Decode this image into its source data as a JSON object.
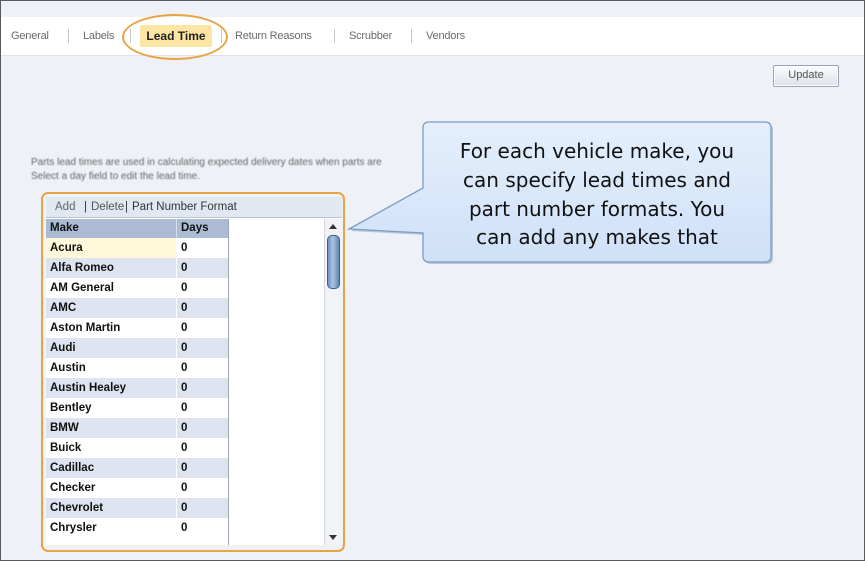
{
  "tabs": [
    {
      "label": "General"
    },
    {
      "label": "Labels"
    },
    {
      "label": "Lead Time",
      "active": true
    },
    {
      "label": "Return Reasons"
    },
    {
      "label": "Scrubber"
    },
    {
      "label": "Vendors"
    }
  ],
  "update_button": "Update",
  "description": {
    "line1": "Parts lead times are used in calculating expected delivery dates when parts are",
    "line2": "Select a day field to edit the lead time."
  },
  "toolbar": {
    "add": "Add",
    "sep1": "|",
    "delete": "Delete",
    "sep2": "|",
    "part_number_format": "Part Number Format"
  },
  "grid": {
    "columns": [
      "Make",
      "Days"
    ],
    "rows": [
      {
        "make": "Acura",
        "days": "0"
      },
      {
        "make": "Alfa Romeo",
        "days": "0"
      },
      {
        "make": "AM General",
        "days": "0"
      },
      {
        "make": "AMC",
        "days": "0"
      },
      {
        "make": "Aston Martin",
        "days": "0"
      },
      {
        "make": "Audi",
        "days": "0"
      },
      {
        "make": "Austin",
        "days": "0"
      },
      {
        "make": "Austin Healey",
        "days": "0"
      },
      {
        "make": "Bentley",
        "days": "0"
      },
      {
        "make": "BMW",
        "days": "0"
      },
      {
        "make": "Buick",
        "days": "0"
      },
      {
        "make": "Cadillac",
        "days": "0"
      },
      {
        "make": "Checker",
        "days": "0"
      },
      {
        "make": "Chevrolet",
        "days": "0"
      },
      {
        "make": "Chrysler",
        "days": "0"
      }
    ]
  },
  "callout": {
    "lines": [
      "For each vehicle make, you",
      "can specify lead times and",
      "part number formats. You",
      "can add any makes that"
    ]
  },
  "colors": {
    "highlight_ring": "#e8a343",
    "active_tab_bg": "#fde6a3",
    "callout_fill": "#d8e8fb",
    "callout_border": "#7a9cc6",
    "grid_header": "#aabbd3",
    "row_alt": "#dde4ef"
  }
}
